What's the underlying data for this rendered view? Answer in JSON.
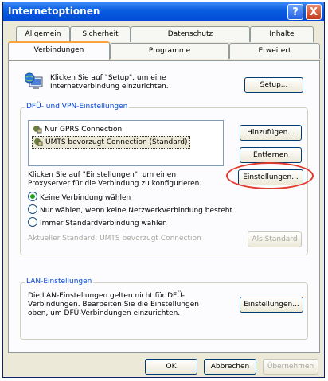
{
  "window": {
    "title": "Internetoptionen"
  },
  "titlebar": {
    "help_glyph": "?",
    "close_glyph": "X"
  },
  "tabs": [
    {
      "label": "Allgemein"
    },
    {
      "label": "Sicherheit"
    },
    {
      "label": "Datenschutz"
    },
    {
      "label": "Inhalte"
    },
    {
      "label": "Verbindungen",
      "active": true
    },
    {
      "label": "Programme"
    },
    {
      "label": "Erweitert"
    }
  ],
  "setup": {
    "text_line1": "Klicken Sie auf \"Setup\", um eine",
    "text_line2": "Internetverbindung einzurichten.",
    "button": "Setup..."
  },
  "dfu": {
    "legend": "DFÜ- und VPN-Einstellungen",
    "items": [
      {
        "label": "Nur GPRS Connection",
        "selected": false
      },
      {
        "label": "UMTS bevorzugt Connection (Standard)",
        "selected": true
      }
    ],
    "add_button": "Hinzufügen...",
    "remove_button": "Entfernen",
    "proxy_text_line1": "Klicken Sie auf \"Einstellungen\", um einen",
    "proxy_text_line2": "Proxyserver für die Verbindung zu konfigurieren.",
    "settings_button": "Einstellungen...",
    "radios": [
      {
        "label": "Keine Verbindung wählen",
        "checked": true
      },
      {
        "label": "Nur wählen, wenn keine Netzwerkverbindung besteht",
        "checked": false
      },
      {
        "label": "Immer Standardverbindung wählen",
        "checked": false
      }
    ],
    "current_default": "Aktueller Standard:  UMTS bevorzugt Connection",
    "as_default_button": "Als Standard"
  },
  "lan": {
    "legend": "LAN-Einstellungen",
    "text_line1": "Die LAN-Einstellungen gelten nicht für DFÜ-",
    "text_line2": "Verbindungen. Bearbeiten Sie die Einstellungen",
    "text_line3": "oben, um DFÜ-Verbindungen einzurichten.",
    "settings_button": "Einstellungen..."
  },
  "footer": {
    "ok": "OK",
    "cancel": "Abbrechen",
    "apply": "Übernehmen"
  },
  "colors": {
    "titlebar": "#0a5ee0",
    "highlight_circle": "#e23a2c",
    "group_legend": "#0046d5"
  }
}
